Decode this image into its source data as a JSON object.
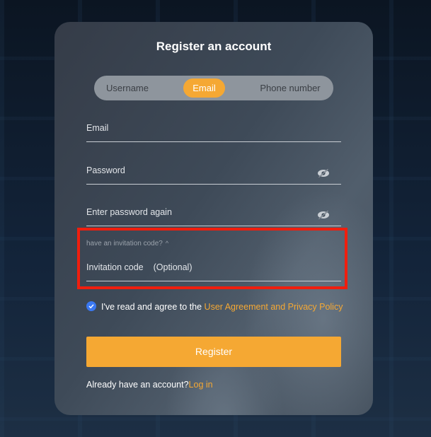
{
  "title": "Register an account",
  "tabs": [
    {
      "label": "Username",
      "active": false
    },
    {
      "label": "Email",
      "active": true
    },
    {
      "label": "Phone number",
      "active": false
    }
  ],
  "fields": {
    "email": {
      "placeholder": "Email",
      "value": ""
    },
    "password": {
      "placeholder": "Password",
      "value": "",
      "icon": "eye-slash-icon"
    },
    "confirm_password": {
      "placeholder": "Enter password again",
      "value": "",
      "icon": "eye-slash-icon"
    },
    "invitation": {
      "toggle_label": "have an invitation code?",
      "toggle_icon": "chevron-up-icon",
      "placeholder": "Invitation code",
      "optional_label": "(Optional)",
      "value": ""
    }
  },
  "agreement": {
    "checked": true,
    "text": "I've read and agree to the ",
    "link_text": "User Agreement and Privacy Policy"
  },
  "register_button": "Register",
  "login_prompt": {
    "text": "Already have an account?",
    "link_text": "Log in"
  },
  "colors": {
    "accent": "#f5a833",
    "checkbox": "#3a78f2",
    "highlight": "#f01e0e"
  }
}
